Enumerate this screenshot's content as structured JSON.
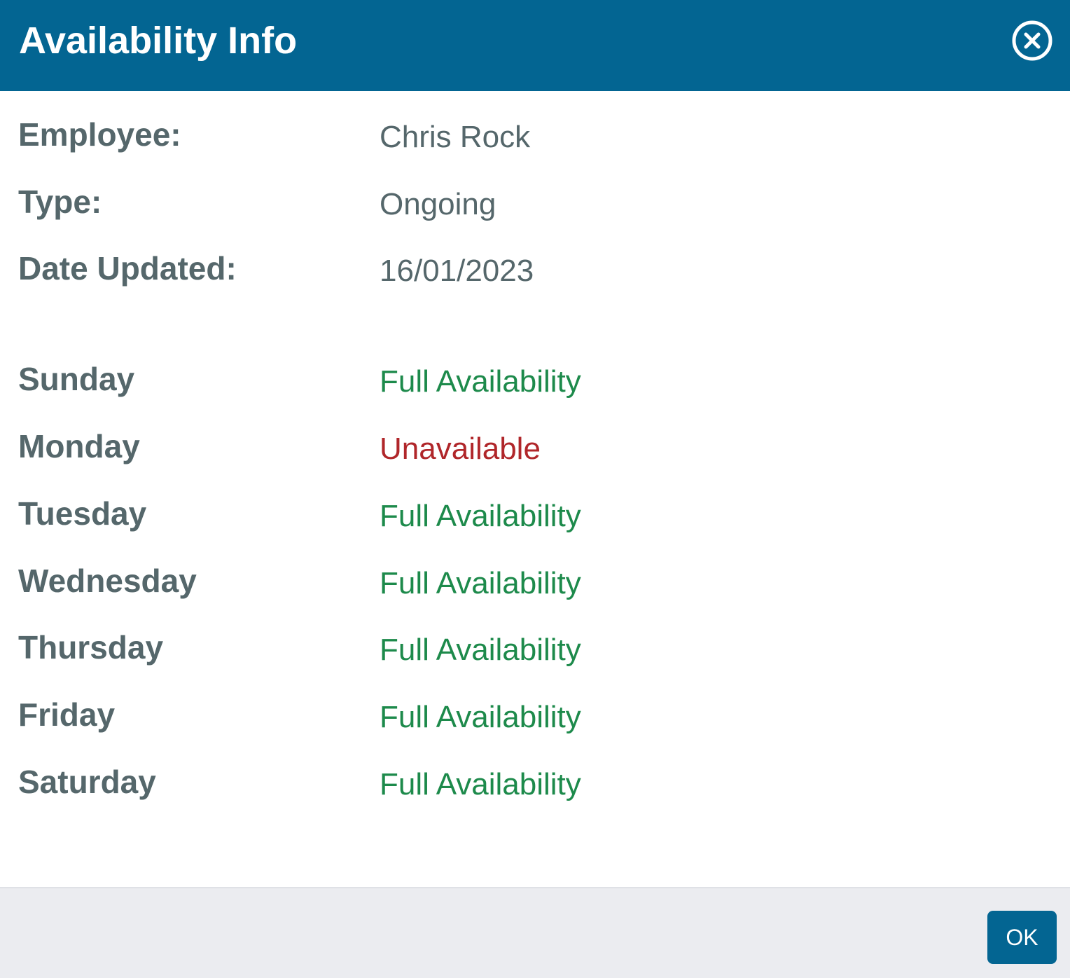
{
  "dialog": {
    "title": "Availability Info",
    "close_icon": "close-circle-icon",
    "ok_label": "OK"
  },
  "details": [
    {
      "label": "Employee:",
      "value": "Chris Rock"
    },
    {
      "label": "Type:",
      "value": "Ongoing"
    },
    {
      "label": "Date Updated:",
      "value": "16/01/2023"
    }
  ],
  "days": [
    {
      "label": "Sunday",
      "status": "Full Availability",
      "state": "available"
    },
    {
      "label": "Monday",
      "status": "Unavailable",
      "state": "unavailable"
    },
    {
      "label": "Tuesday",
      "status": "Full Availability",
      "state": "available"
    },
    {
      "label": "Wednesday",
      "status": "Full Availability",
      "state": "available"
    },
    {
      "label": "Thursday",
      "status": "Full Availability",
      "state": "available"
    },
    {
      "label": "Friday",
      "status": "Full Availability",
      "state": "available"
    },
    {
      "label": "Saturday",
      "status": "Full Availability",
      "state": "available"
    }
  ],
  "colors": {
    "header_bg": "#036592",
    "label_text": "#55676b",
    "available": "#1d8a4b",
    "unavailable": "#b0262a",
    "footer_bg": "#ebecf0"
  }
}
